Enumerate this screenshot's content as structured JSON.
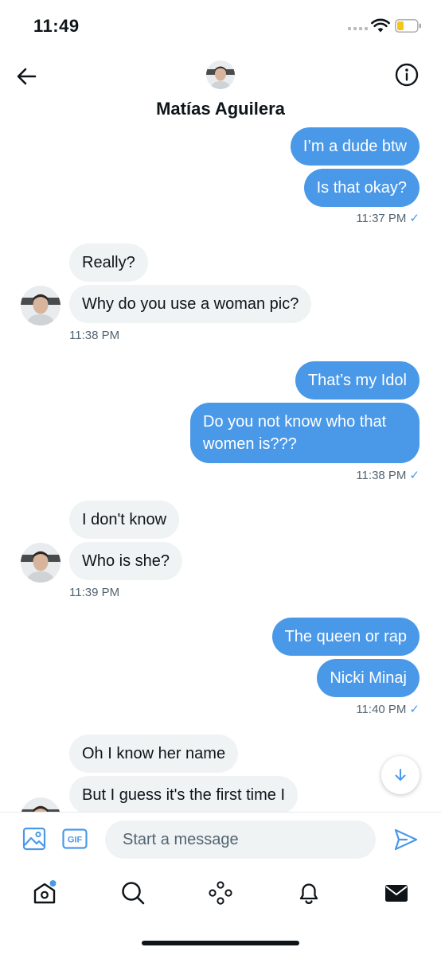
{
  "status_bar": {
    "time": "11:49"
  },
  "header": {
    "contact_name": "Matías Aguilera",
    "back_icon": "arrow-left-icon",
    "info_icon": "info-circle-icon"
  },
  "messages": [
    {
      "dir": "out",
      "text": "I’m a dude btw"
    },
    {
      "dir": "out",
      "text": "Is that okay?"
    },
    {
      "type": "timestamp",
      "dir": "out",
      "text": "11:37 PM",
      "read": "✓"
    },
    {
      "dir": "in",
      "text": "Really?"
    },
    {
      "dir": "in",
      "text": "Why do you use a woman pic?"
    },
    {
      "type": "timestamp",
      "dir": "in",
      "text": "11:38 PM"
    },
    {
      "dir": "out",
      "text": "That’s my Idol"
    },
    {
      "dir": "out",
      "text": "Do you not know who that women is???"
    },
    {
      "type": "timestamp",
      "dir": "out",
      "text": "11:38 PM",
      "read": "✓"
    },
    {
      "dir": "in",
      "text": "I don't know"
    },
    {
      "dir": "in",
      "text": "Who is she?"
    },
    {
      "type": "timestamp",
      "dir": "in",
      "text": "11:39 PM"
    },
    {
      "dir": "out",
      "text": "The queen or rap"
    },
    {
      "dir": "out",
      "text": "Nicki Minaj"
    },
    {
      "type": "timestamp",
      "dir": "out",
      "text": "11:40 PM",
      "read": "✓"
    },
    {
      "dir": "in",
      "text": "Oh I know her name"
    },
    {
      "dir": "in",
      "text": "But I guess it's the first time I"
    }
  ],
  "composer": {
    "placeholder": "Start a message",
    "gif_label": "GIF"
  },
  "nav": [
    "home-icon",
    "search-icon",
    "spaces-icon",
    "notifications-bell-icon",
    "messages-envelope-icon"
  ],
  "colors": {
    "accent": "#4a99e9",
    "incoming_bubble": "#eff3f4",
    "text": "#0f1419",
    "muted": "#536471"
  }
}
